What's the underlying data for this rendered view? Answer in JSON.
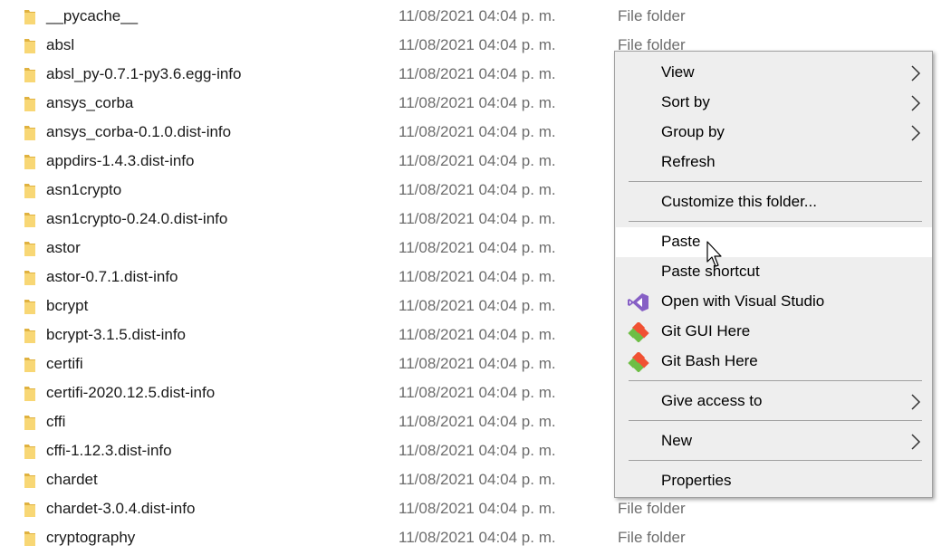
{
  "file_list": {
    "rows": [
      {
        "name": "__pycache__",
        "date": "11/08/2021 04:04 p. m.",
        "type": "File folder"
      },
      {
        "name": "absl",
        "date": "11/08/2021 04:04 p. m.",
        "type": "File folder"
      },
      {
        "name": "absl_py-0.7.1-py3.6.egg-info",
        "date": "11/08/2021 04:04 p. m.",
        "type": ""
      },
      {
        "name": "ansys_corba",
        "date": "11/08/2021 04:04 p. m.",
        "type": ""
      },
      {
        "name": "ansys_corba-0.1.0.dist-info",
        "date": "11/08/2021 04:04 p. m.",
        "type": ""
      },
      {
        "name": "appdirs-1.4.3.dist-info",
        "date": "11/08/2021 04:04 p. m.",
        "type": ""
      },
      {
        "name": "asn1crypto",
        "date": "11/08/2021 04:04 p. m.",
        "type": ""
      },
      {
        "name": "asn1crypto-0.24.0.dist-info",
        "date": "11/08/2021 04:04 p. m.",
        "type": ""
      },
      {
        "name": "astor",
        "date": "11/08/2021 04:04 p. m.",
        "type": ""
      },
      {
        "name": "astor-0.7.1.dist-info",
        "date": "11/08/2021 04:04 p. m.",
        "type": ""
      },
      {
        "name": "bcrypt",
        "date": "11/08/2021 04:04 p. m.",
        "type": ""
      },
      {
        "name": "bcrypt-3.1.5.dist-info",
        "date": "11/08/2021 04:04 p. m.",
        "type": ""
      },
      {
        "name": "certifi",
        "date": "11/08/2021 04:04 p. m.",
        "type": ""
      },
      {
        "name": "certifi-2020.12.5.dist-info",
        "date": "11/08/2021 04:04 p. m.",
        "type": ""
      },
      {
        "name": "cffi",
        "date": "11/08/2021 04:04 p. m.",
        "type": ""
      },
      {
        "name": "cffi-1.12.3.dist-info",
        "date": "11/08/2021 04:04 p. m.",
        "type": ""
      },
      {
        "name": "chardet",
        "date": "11/08/2021 04:04 p. m.",
        "type": ""
      },
      {
        "name": "chardet-3.0.4.dist-info",
        "date": "11/08/2021 04:04 p. m.",
        "type": "File folder"
      },
      {
        "name": "cryptography",
        "date": "11/08/2021 04:04 p. m.",
        "type": "File folder"
      }
    ]
  },
  "context_menu": {
    "items": {
      "view": "View",
      "sort_by": "Sort by",
      "group_by": "Group by",
      "refresh": "Refresh",
      "customize": "Customize this folder...",
      "paste": "Paste",
      "paste_shortcut": "Paste shortcut",
      "open_vs": "Open with Visual Studio",
      "git_gui": "Git GUI Here",
      "git_bash": "Git Bash Here",
      "give_access": "Give access to",
      "new": "New",
      "properties": "Properties"
    },
    "hovered_item": "paste"
  },
  "icons": {
    "folder": "folder-icon",
    "visual_studio": "visual-studio-icon",
    "git": "git-icon",
    "submenu": "chevron-right-icon",
    "cursor": "mouse-pointer-icon"
  },
  "colors": {
    "folder_yellow": "#f8d775",
    "folder_dark": "#e0b240",
    "menu_background": "#eeeeee",
    "menu_hover": "#ffffff",
    "secondary_text": "#6d6d6d",
    "vs_purple": "#865fc5",
    "git_orange": "#f05133",
    "git_green": "#6dbe45"
  }
}
